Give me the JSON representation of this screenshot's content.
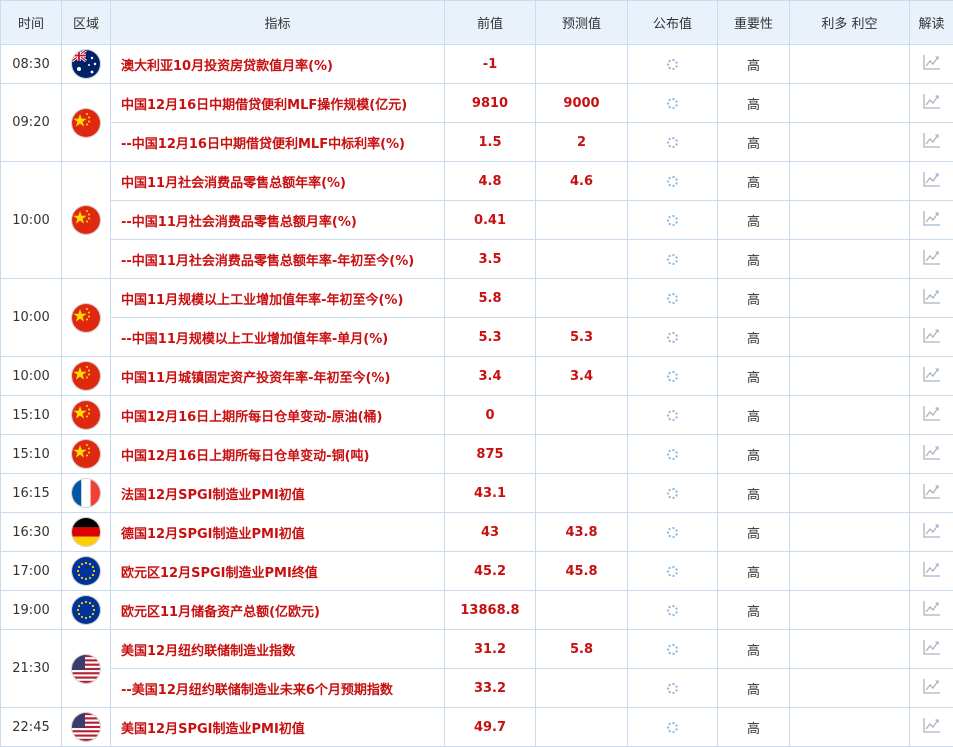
{
  "header": [
    "时间",
    "区域",
    "指标",
    "前值",
    "预测值",
    "公布值",
    "重要性",
    "利多 利空",
    "解读"
  ],
  "flag_icons": {
    "au": "australia-flag-icon",
    "cn": "china-flag-icon",
    "fr": "france-flag-icon",
    "de": "germany-flag-icon",
    "eu": "eu-flag-icon",
    "us": "usa-flag-icon"
  },
  "colors": {
    "indicator": "#c81010",
    "header_bg": "#e9f1fb",
    "border": "#c9dbef"
  },
  "groups": [
    {
      "time": "08:30",
      "flag": "au",
      "rows": [
        {
          "name": "澳大利亚10月投资房贷款值月率(%)",
          "prev": "-1",
          "forecast": "",
          "importance": "高"
        }
      ]
    },
    {
      "time": "09:20",
      "flag": "cn",
      "rows": [
        {
          "name": "中国12月16日中期借贷便利MLF操作规模(亿元)",
          "prev": "9810",
          "forecast": "9000",
          "importance": "高"
        },
        {
          "name": "--中国12月16日中期借贷便利MLF中标利率(%)",
          "prev": "1.5",
          "forecast": "2",
          "importance": "高"
        }
      ]
    },
    {
      "time": "10:00",
      "flag": "cn",
      "rows": [
        {
          "name": "中国11月社会消费品零售总额年率(%)",
          "prev": "4.8",
          "forecast": "4.6",
          "importance": "高"
        },
        {
          "name": "--中国11月社会消费品零售总额月率(%)",
          "prev": "0.41",
          "forecast": "",
          "importance": "高"
        },
        {
          "name": "--中国11月社会消费品零售总额年率-年初至今(%)",
          "prev": "3.5",
          "forecast": "",
          "importance": "高"
        }
      ]
    },
    {
      "time": "10:00",
      "flag": "cn",
      "rows": [
        {
          "name": "中国11月规模以上工业增加值年率-年初至今(%)",
          "prev": "5.8",
          "forecast": "",
          "importance": "高"
        },
        {
          "name": "--中国11月规模以上工业增加值年率-单月(%)",
          "prev": "5.3",
          "forecast": "5.3",
          "importance": "高"
        }
      ]
    },
    {
      "time": "10:00",
      "flag": "cn",
      "rows": [
        {
          "name": "中国11月城镇固定资产投资年率-年初至今(%)",
          "prev": "3.4",
          "forecast": "3.4",
          "importance": "高"
        }
      ]
    },
    {
      "time": "15:10",
      "flag": "cn",
      "rows": [
        {
          "name": "中国12月16日上期所每日仓单变动-原油(桶)",
          "prev": "0",
          "forecast": "",
          "importance": "高"
        }
      ]
    },
    {
      "time": "15:10",
      "flag": "cn",
      "rows": [
        {
          "name": "中国12月16日上期所每日仓单变动-铜(吨)",
          "prev": "875",
          "forecast": "",
          "importance": "高"
        }
      ]
    },
    {
      "time": "16:15",
      "flag": "fr",
      "rows": [
        {
          "name": "法国12月SPGI制造业PMI初值",
          "prev": "43.1",
          "forecast": "",
          "importance": "高"
        }
      ]
    },
    {
      "time": "16:30",
      "flag": "de",
      "rows": [
        {
          "name": "德国12月SPGI制造业PMI初值",
          "prev": "43",
          "forecast": "43.8",
          "importance": "高"
        }
      ]
    },
    {
      "time": "17:00",
      "flag": "eu",
      "rows": [
        {
          "name": "欧元区12月SPGI制造业PMI终值",
          "prev": "45.2",
          "forecast": "45.8",
          "importance": "高"
        }
      ]
    },
    {
      "time": "19:00",
      "flag": "eu",
      "rows": [
        {
          "name": "欧元区11月储备资产总额(亿欧元)",
          "prev": "13868.8",
          "forecast": "",
          "importance": "高"
        }
      ]
    },
    {
      "time": "21:30",
      "flag": "us",
      "rows": [
        {
          "name": "美国12月纽约联储制造业指数",
          "prev": "31.2",
          "forecast": "5.8",
          "importance": "高"
        },
        {
          "name": "--美国12月纽约联储制造业未来6个月预期指数",
          "prev": "33.2",
          "forecast": "",
          "importance": "高"
        }
      ]
    },
    {
      "time": "22:45",
      "flag": "us",
      "rows": [
        {
          "name": "美国12月SPGI制造业PMI初值",
          "prev": "49.7",
          "forecast": "",
          "importance": "高"
        }
      ]
    }
  ]
}
